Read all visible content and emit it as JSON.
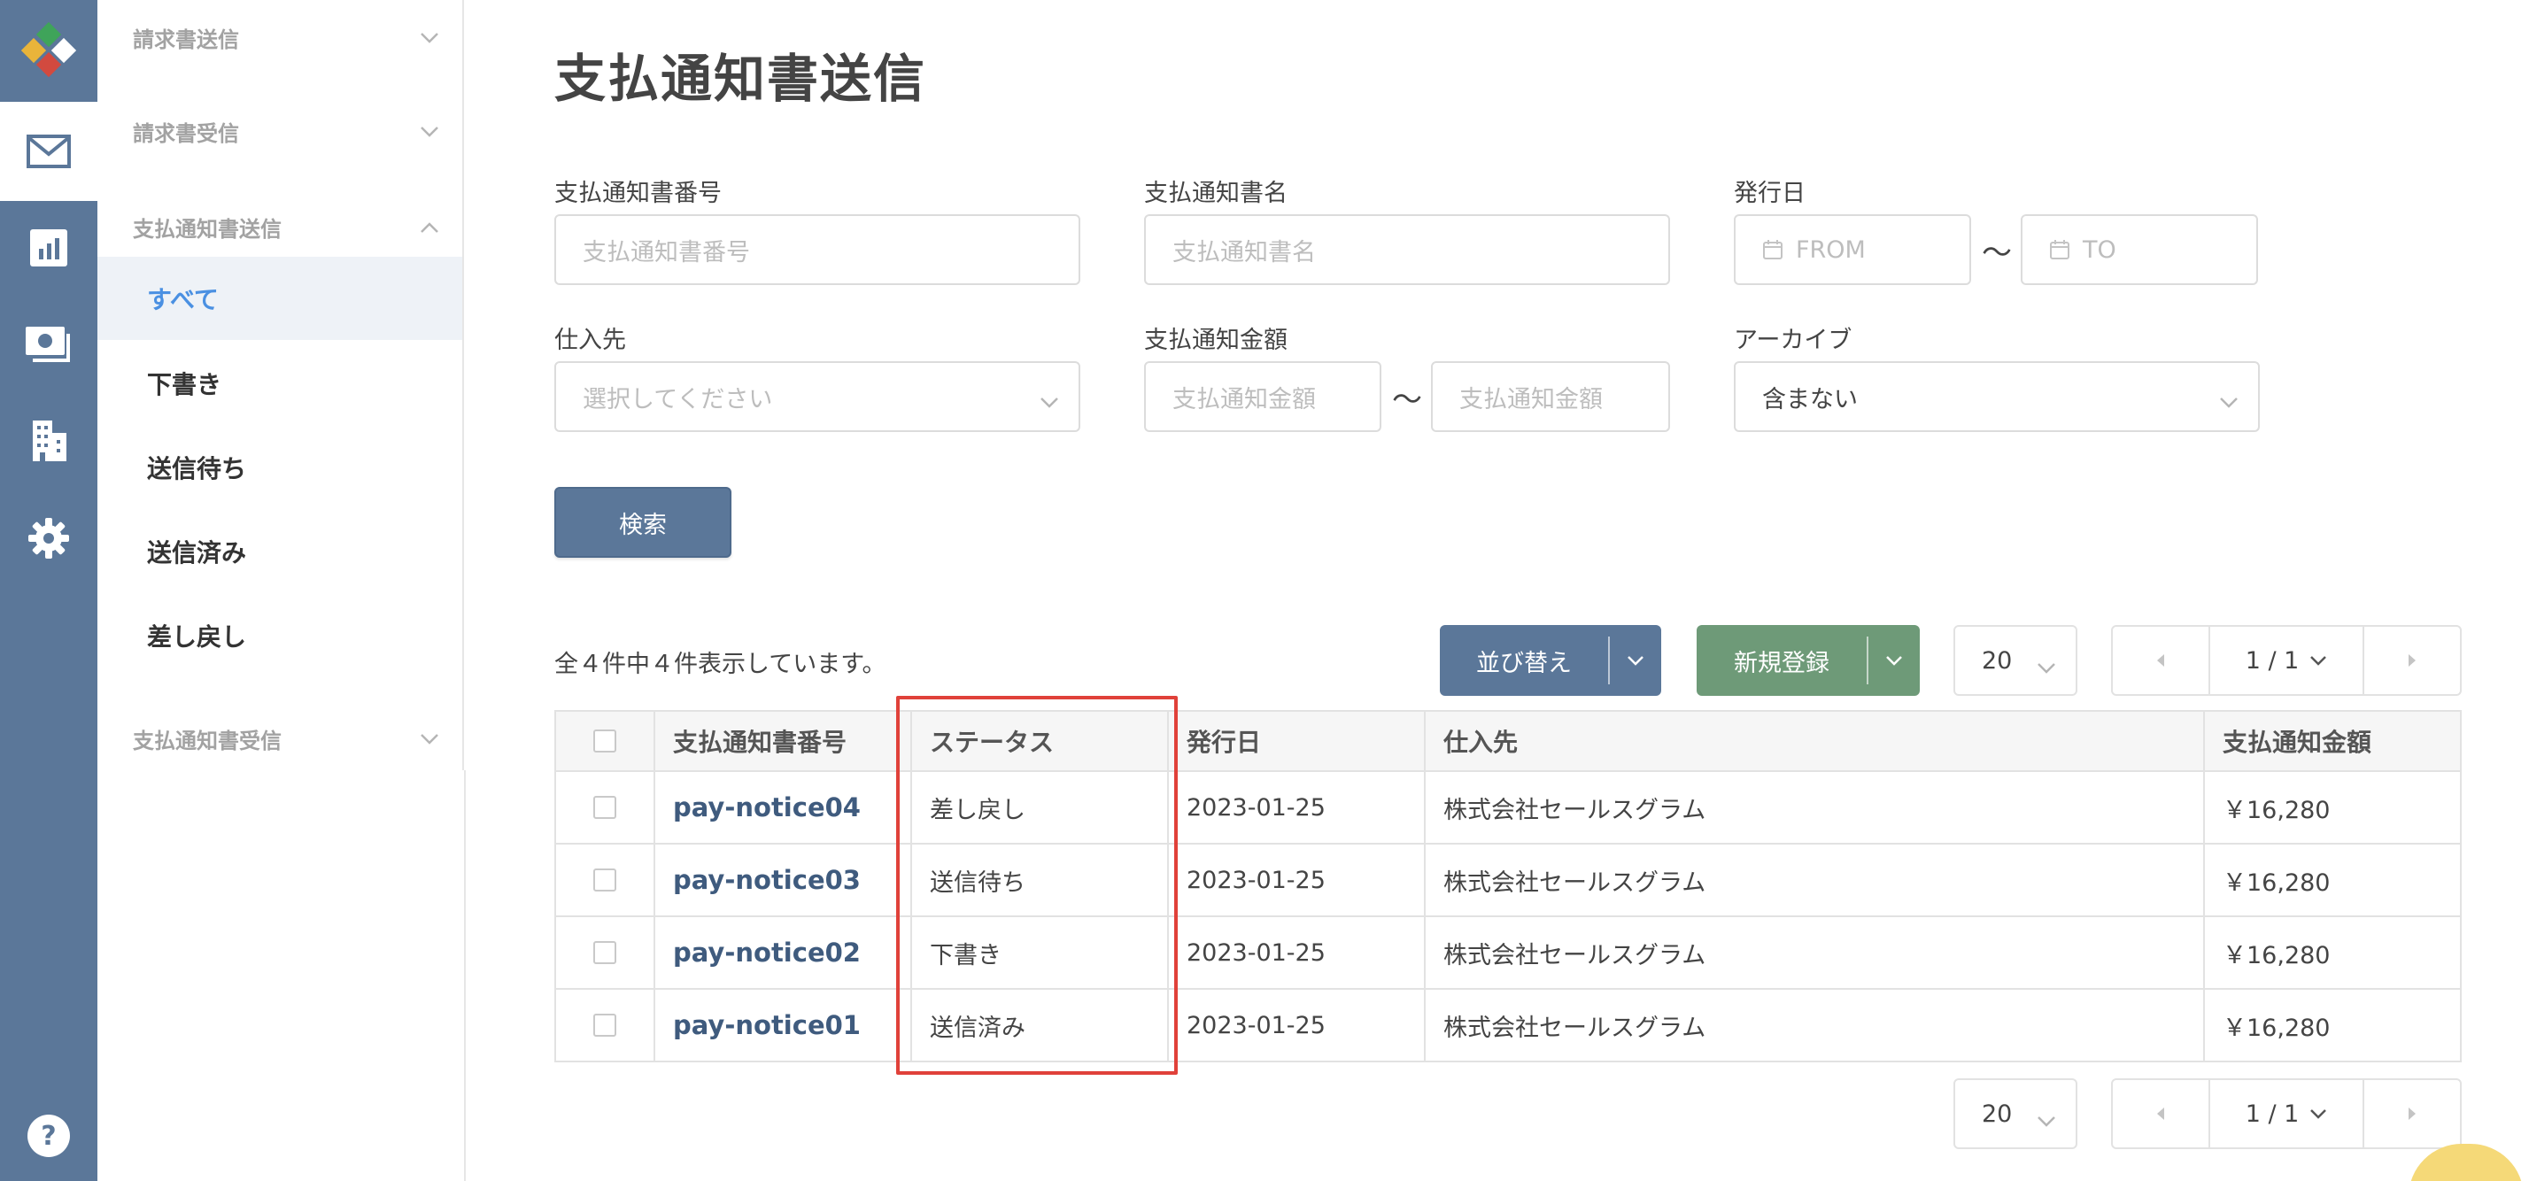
{
  "sidebar": {
    "groups": [
      {
        "label": "請求書送信"
      },
      {
        "label": "請求書受信"
      },
      {
        "label": "支払通知書送信"
      },
      {
        "label": "支払通知書受信"
      }
    ],
    "items": [
      {
        "label": "すべて"
      },
      {
        "label": "下書き"
      },
      {
        "label": "送信待ち"
      },
      {
        "label": "送信済み"
      },
      {
        "label": "差し戻し"
      }
    ],
    "rail_icons": [
      "logo-icon",
      "mail-icon",
      "chart-icon",
      "money-icon",
      "building-icon",
      "gear-icon",
      "help-icon"
    ]
  },
  "page": {
    "title": "支払通知書送信"
  },
  "filters": {
    "number": {
      "label": "支払通知書番号",
      "placeholder": "支払通知書番号"
    },
    "name": {
      "label": "支払通知書名",
      "placeholder": "支払通知書名"
    },
    "issue_date": {
      "label": "発行日",
      "from_placeholder": "FROM",
      "to_placeholder": "TO",
      "separator": "〜"
    },
    "supplier": {
      "label": "仕入先",
      "placeholder": "選択してください"
    },
    "amount": {
      "label": "支払通知金額",
      "min_placeholder": "支払通知金額",
      "max_placeholder": "支払通知金額",
      "separator": "〜"
    },
    "archive": {
      "label": "アーカイブ",
      "value": "含まない"
    },
    "search_label": "検索"
  },
  "toolbar": {
    "count_text": "全４件中４件表示しています。",
    "sort_label": "並び替え",
    "new_label": "新規登録",
    "per_page": "20",
    "page_indicator": "1 / 1"
  },
  "table": {
    "columns": [
      "支払通知書番号",
      "ステータス",
      "発行日",
      "仕入先",
      "支払通知金額"
    ],
    "rows": [
      {
        "number": "pay-notice04",
        "status": "差し戻し",
        "date": "2023-01-25",
        "supplier": "株式会社セールスグラム",
        "amount": "￥16,280"
      },
      {
        "number": "pay-notice03",
        "status": "送信待ち",
        "date": "2023-01-25",
        "supplier": "株式会社セールスグラム",
        "amount": "￥16,280"
      },
      {
        "number": "pay-notice02",
        "status": "下書き",
        "date": "2023-01-25",
        "supplier": "株式会社セールスグラム",
        "amount": "￥16,280"
      },
      {
        "number": "pay-notice01",
        "status": "送信済み",
        "date": "2023-01-25",
        "supplier": "株式会社セールスグラム",
        "amount": "￥16,280"
      }
    ]
  },
  "footer": {
    "per_page": "20",
    "page_indicator": "1 / 1"
  },
  "colors": {
    "rail": "#5b7799",
    "primary_button": "#5b7799",
    "new_button": "#6e9a78",
    "highlight": "#e0413a",
    "link": "#3f5b7e",
    "selected_item": "#4a90e2"
  }
}
